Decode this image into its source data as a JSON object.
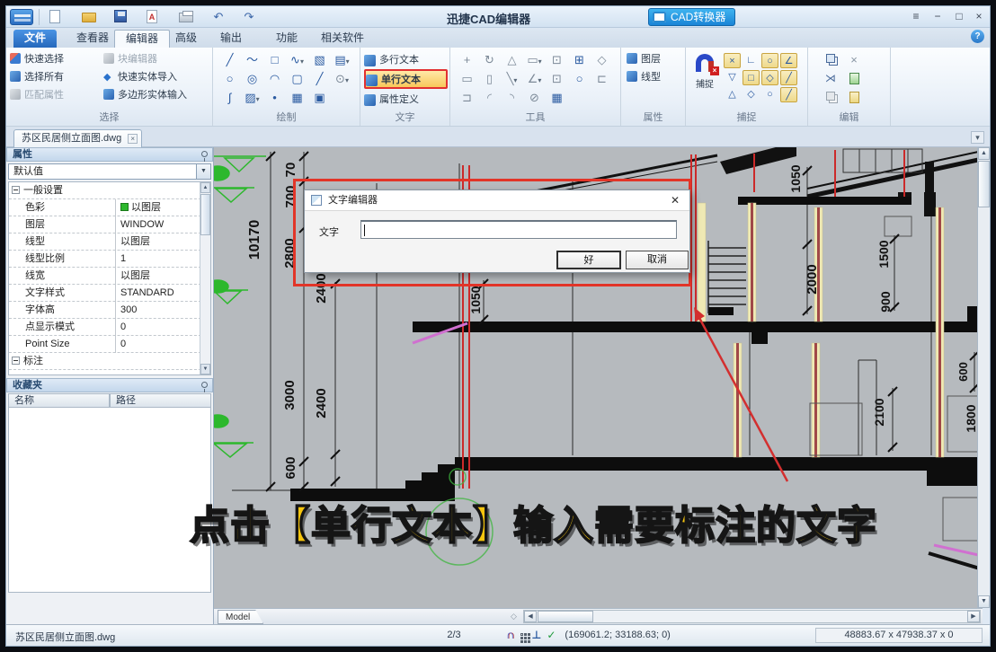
{
  "window": {
    "title": "迅捷CAD编辑器",
    "converter": "CAD转换器"
  },
  "menu": {
    "tabs": [
      {
        "label": "文件"
      },
      {
        "label": "查看器"
      },
      {
        "label": "编辑器"
      },
      {
        "label": "高级"
      },
      {
        "label": "输出"
      },
      {
        "label": "功能"
      },
      {
        "label": "相关软件"
      }
    ]
  },
  "ribbon": {
    "select": {
      "label": "选择",
      "items": [
        {
          "label": "快速选择"
        },
        {
          "label": "块编辑器"
        },
        {
          "label": "选择所有"
        },
        {
          "label": "快速实体导入"
        },
        {
          "label": "匹配属性"
        },
        {
          "label": "多边形实体输入"
        }
      ]
    },
    "draw": {
      "label": "绘制"
    },
    "text": {
      "label": "文字",
      "items": [
        {
          "label": "多行文本"
        },
        {
          "label": "单行文本"
        },
        {
          "label": "属性定义"
        }
      ]
    },
    "tools": {
      "label": "工具"
    },
    "props": {
      "label": "属性",
      "items": [
        {
          "label": "图层"
        },
        {
          "label": "线型"
        }
      ]
    },
    "snap": {
      "label": "捕捉",
      "button": "捕捉"
    },
    "edit": {
      "label": "编辑"
    }
  },
  "tabstrip": {
    "doc_tab": "苏区民居侧立面图.dwg"
  },
  "properties": {
    "title": "属性",
    "preset": "默认值",
    "group_general": "一般设置",
    "rows": [
      {
        "name": "色彩",
        "value": "以图层"
      },
      {
        "name": "图层",
        "value": "WINDOW"
      },
      {
        "name": "线型",
        "value": "以图层"
      },
      {
        "name": "线型比例",
        "value": "1"
      },
      {
        "name": "线宽",
        "value": "以图层"
      },
      {
        "name": "文字样式",
        "value": "STANDARD"
      },
      {
        "name": "字体高",
        "value": "300"
      },
      {
        "name": "点显示模式",
        "value": "0"
      },
      {
        "name": "Point Size",
        "value": "0"
      }
    ],
    "group_dim": "标注"
  },
  "favorites": {
    "title": "收藏夹",
    "col_name": "名称",
    "col_path": "路径"
  },
  "dialog": {
    "title": "文字编辑器",
    "label": "文字",
    "value": "",
    "ok": "好",
    "cancel": "取消"
  },
  "annotation": {
    "text": "点击【单行文本】输入需要标注的文字",
    "color": "#f6c50e"
  },
  "drawing": {
    "model_tab": "Model",
    "dims": {
      "left": [
        "70",
        "700",
        "10170",
        "2800",
        "2400",
        "1050",
        "3000",
        "2400",
        "600"
      ],
      "right": [
        "1050",
        "2000",
        "1500",
        "900",
        "2100",
        "600",
        "1800"
      ]
    }
  },
  "statusbar": {
    "file": "苏区民居侧立面图.dwg",
    "page": "2/3",
    "coords": "(169061.2; 33188.63; 0)",
    "extent": "48883.67 x 47938.37 x 0"
  }
}
